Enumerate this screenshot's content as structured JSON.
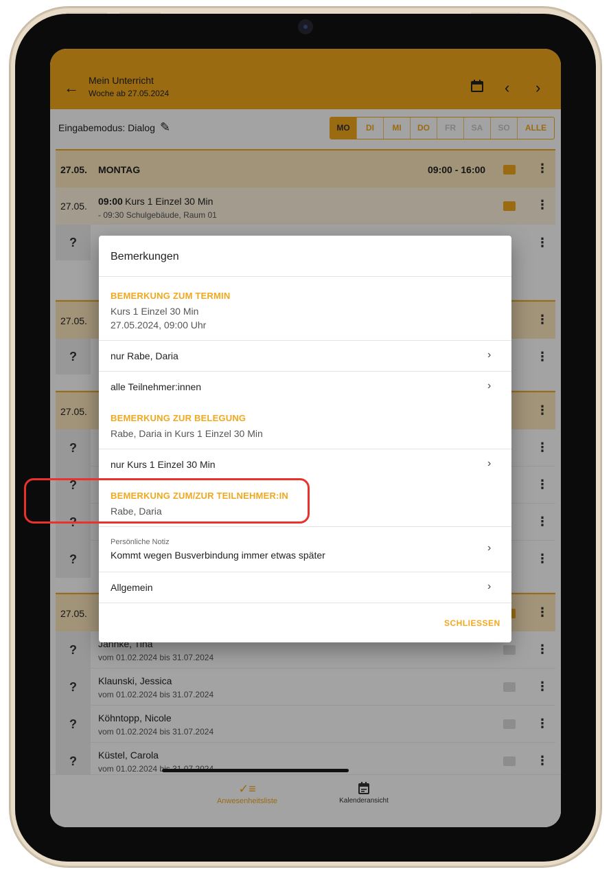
{
  "appbar": {
    "title": "Mein Unterricht",
    "subtitle": "Woche ab 27.05.2024",
    "icons": [
      "arrow-back-icon",
      "calendar-icon",
      "chevron-left-icon",
      "chevron-right-icon"
    ]
  },
  "modebar": {
    "label": "Eingabemodus: Dialog",
    "days": [
      "MO",
      "DI",
      "MI",
      "DO",
      "FR",
      "SA",
      "SO"
    ],
    "all_label": "ALLE",
    "active_day": "MO"
  },
  "schedule": {
    "day_date": "27.05.",
    "day_name": "MONTAG",
    "day_time": "09:00 - 16:00",
    "course": {
      "date": "27.05.",
      "time": "09:00",
      "name": "Kurs 1 Einzel 30 Min",
      "detail": "- 09:30 Schulgebäude, Raum 01"
    },
    "group_dates": [
      "27.05.",
      "27.05.",
      "27.05."
    ],
    "participants": [
      {
        "status": "?",
        "name": "Jahnke, Tina",
        "period": "vom 01.02.2024 bis 31.07.2024"
      },
      {
        "status": "?",
        "name": "Klaunski, Jessica",
        "period": "vom 01.02.2024 bis 31.07.2024"
      },
      {
        "status": "?",
        "name": "Köhntopp, Nicole",
        "period": "vom 01.02.2024 bis 31.07.2024"
      },
      {
        "status": "?",
        "name": "Küstel, Carola",
        "period": "vom 01.02.2024 bis 31.07.2024"
      }
    ],
    "hidden_status": "?"
  },
  "bottomnav": {
    "attendance_label": "Anwesenheitsliste",
    "calendar_label": "Kalenderansicht"
  },
  "dialog": {
    "title": "Bemerkungen",
    "section_termin": "BEMERKUNG ZUM TERMIN",
    "termin_line1": "Kurs 1 Einzel 30 Min",
    "termin_line2": "27.05.2024, 09:00 Uhr",
    "item_nur_rabe": "nur Rabe, Daria",
    "item_alle": "alle Teilnehmer:innen",
    "section_belegung": "BEMERKUNG ZUR BELEGUNG",
    "belegung_line": "Rabe, Daria in Kurs 1 Einzel 30 Min",
    "item_nur_kurs": "nur Kurs 1 Einzel 30 Min",
    "section_teilnehmer": "BEMERKUNG ZUM/ZUR TEILNEHMER:IN",
    "teilnehmer_line": "Rabe, Daria",
    "note_label": "Persönliche Notiz",
    "note_value": "Kommt wegen Busverbindung immer etwas später",
    "item_allgemein": "Allgemein",
    "close_label": "SCHLIESSEN"
  },
  "colors": {
    "accent": "#f2a81d",
    "highlight": "#e9322b"
  }
}
